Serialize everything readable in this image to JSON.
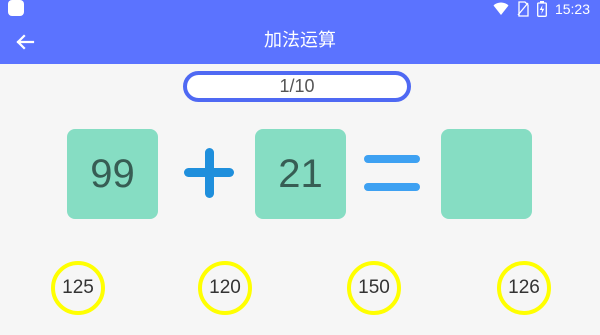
{
  "status_bar": {
    "time": "15:23",
    "icons": [
      "app-square-icon",
      "wifi-icon",
      "no-sim-icon",
      "battery-charging-icon"
    ]
  },
  "toolbar": {
    "back_icon": "arrow-left-icon",
    "title": "加法运算"
  },
  "progress": {
    "text": "1/10"
  },
  "equation": {
    "operand_a": "99",
    "operator": "plus-icon",
    "operand_b": "21",
    "equals": "equals-icon",
    "answer": ""
  },
  "choices": [
    {
      "label": "125"
    },
    {
      "label": "120"
    },
    {
      "label": "150"
    },
    {
      "label": "126"
    }
  ],
  "colors": {
    "header_bg": "#5b73ff",
    "page_bg": "#f6f6f6",
    "tile_bg": "#86ddc3",
    "tile_text": "#375d54",
    "operator": "#1f8fdc",
    "equals": "#3ea1f2",
    "choice_border": "#ffff00",
    "progress_border": "#4f69f3"
  }
}
